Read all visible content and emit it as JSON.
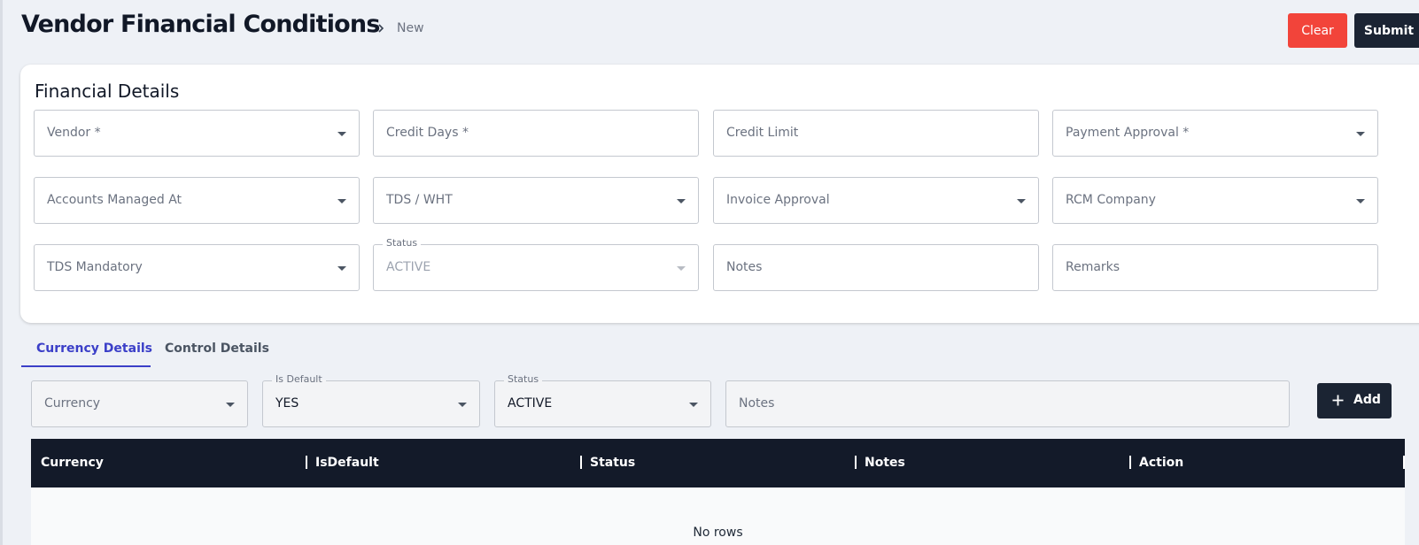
{
  "header": {
    "title": "Vendor Financial Conditions",
    "breadcrumb_current": "New",
    "clear_label": "Clear",
    "submit_label": "Submit"
  },
  "financial_details": {
    "title": "Financial Details",
    "fields": {
      "vendor": {
        "placeholder": "Vendor *",
        "type": "select"
      },
      "credit_days": {
        "placeholder": "Credit Days *",
        "type": "text"
      },
      "credit_limit": {
        "placeholder": "Credit Limit",
        "type": "text"
      },
      "payment_approval": {
        "placeholder": "Payment Approval *",
        "type": "select"
      },
      "accounts_managed_at": {
        "placeholder": "Accounts Managed At",
        "type": "select"
      },
      "tds_wht": {
        "placeholder": "TDS / WHT",
        "type": "select"
      },
      "invoice_approval": {
        "placeholder": "Invoice Approval",
        "type": "select"
      },
      "rcm_company": {
        "placeholder": "RCM Company",
        "type": "select"
      },
      "tds_mandatory": {
        "placeholder": "TDS Mandatory",
        "type": "select"
      },
      "status": {
        "label": "Status",
        "value": "ACTIVE",
        "type": "select",
        "disabled": true
      },
      "notes": {
        "placeholder": "Notes",
        "type": "text"
      },
      "remarks": {
        "placeholder": "Remarks",
        "type": "text"
      }
    }
  },
  "tabs": [
    {
      "label": "Currency Details",
      "active": true
    },
    {
      "label": "Control Details",
      "active": false
    }
  ],
  "currency_form": {
    "currency": {
      "placeholder": "Currency"
    },
    "is_default": {
      "label": "Is Default",
      "value": "YES"
    },
    "status": {
      "label": "Status",
      "value": "ACTIVE"
    },
    "notes": {
      "placeholder": "Notes"
    },
    "add_label": "Add"
  },
  "currency_table": {
    "columns": [
      "Currency",
      "IsDefault",
      "Status",
      "Notes",
      "Action"
    ],
    "rows": [],
    "empty_text": "No rows"
  },
  "icons": {
    "breadcrumb": "chevron-right-icon",
    "dropdown": "caret-down-icon",
    "add": "plus-icon"
  },
  "colors": {
    "clear_button": "#f2443a",
    "primary_dark": "#1b2433",
    "table_header": "#131a29",
    "active_tab": "#3b3fc8",
    "background": "#eef1f6"
  }
}
